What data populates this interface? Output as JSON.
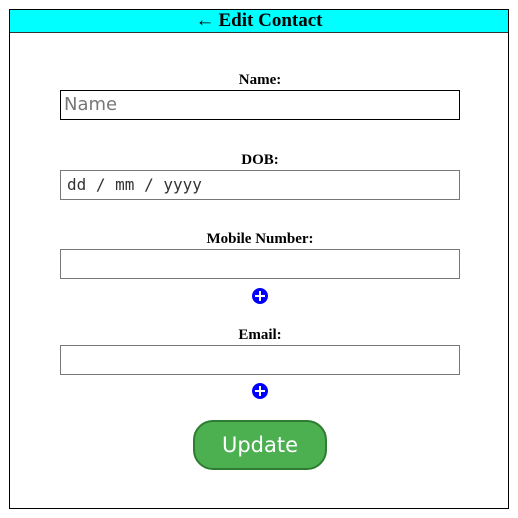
{
  "header": {
    "back_icon": "←",
    "title": "Edit Contact"
  },
  "form": {
    "name": {
      "label": "Name:",
      "placeholder": "Name",
      "value": ""
    },
    "dob": {
      "label": "DOB:",
      "value": "dd / mm / yyyy"
    },
    "mobile": {
      "label": "Mobile Number:",
      "value": "",
      "add_icon": "plus-circle-icon"
    },
    "email": {
      "label": "Email:",
      "value": "",
      "add_icon": "plus-circle-icon"
    }
  },
  "actions": {
    "update_label": "Update"
  },
  "colors": {
    "header_bg": "#00ffff",
    "add_icon": "#0000ff",
    "update_bg": "#4caf50"
  }
}
